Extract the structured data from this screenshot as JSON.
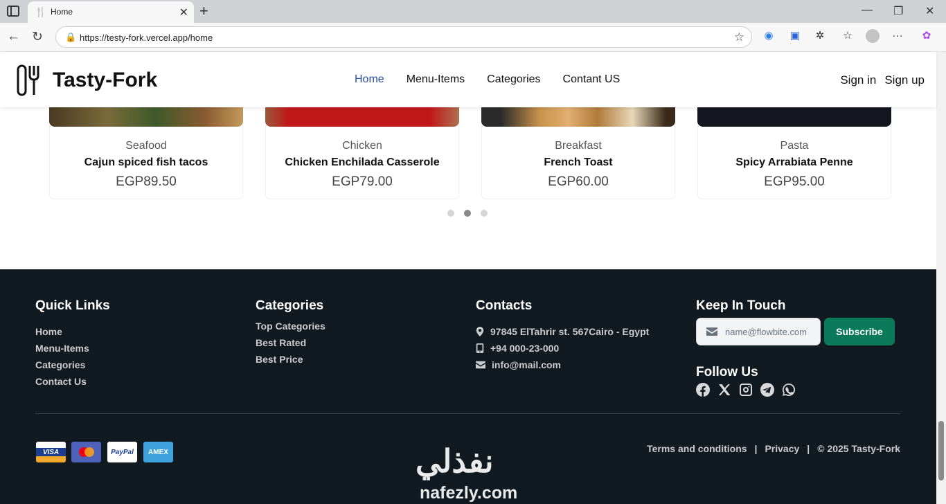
{
  "browser": {
    "tab_title": "Home",
    "url": "https://testy-fork.vercel.app/home"
  },
  "header": {
    "brand": "Tasty-Fork",
    "nav": [
      "Home",
      "Menu-Items",
      "Categories",
      "Contant US"
    ],
    "active_nav": "Home",
    "sign_in": "Sign in",
    "sign_up": "Sign up"
  },
  "products": [
    {
      "category": "Seafood",
      "name": "Cajun spiced fish tacos",
      "price": "EGP89.50"
    },
    {
      "category": "Chicken",
      "name": "Chicken Enchilada Casserole",
      "price": "EGP79.00"
    },
    {
      "category": "Breakfast",
      "name": "French Toast",
      "price": "EGP60.00"
    },
    {
      "category": "Pasta",
      "name": "Spicy Arrabiata Penne",
      "price": "EGP95.00"
    }
  ],
  "carousel": {
    "page_count": 3,
    "active_page": 2
  },
  "footer": {
    "quick_links": {
      "title": "Quick Links",
      "items": [
        "Home",
        "Menu-Items",
        "Categories",
        "Contact Us"
      ]
    },
    "categories": {
      "title": "Categories",
      "items": [
        "Top Categories",
        "Best Rated",
        "Best Price"
      ]
    },
    "contacts": {
      "title": "Contacts",
      "address": "97845 ElTahrir st. 567Cairo - Egypt",
      "phone": "+94 000-23-000",
      "email": "info@mail.com"
    },
    "keep_in_touch": {
      "title": "Keep In Touch",
      "email_placeholder": "name@flowbite.com",
      "subscribe": "Subscribe"
    },
    "follow_us": {
      "title": "Follow Us",
      "icons": [
        "facebook-icon",
        "x-icon",
        "instagram-icon",
        "telegram-icon",
        "whatsapp-icon"
      ]
    },
    "payments": [
      "VISA",
      "mastercard",
      "PayPal",
      "AMEX"
    ],
    "legal": {
      "terms": "Terms and conditions",
      "privacy": "Privacy",
      "copyright": "© 2025 Tasty-Fork"
    }
  },
  "watermark": {
    "arabic": "نفذلي",
    "latin": "nafezly.com"
  },
  "colors": {
    "accent_nav": "#2a4fa0",
    "footer_bg": "#111a21",
    "subscribe_bg": "#0b7a5a"
  }
}
